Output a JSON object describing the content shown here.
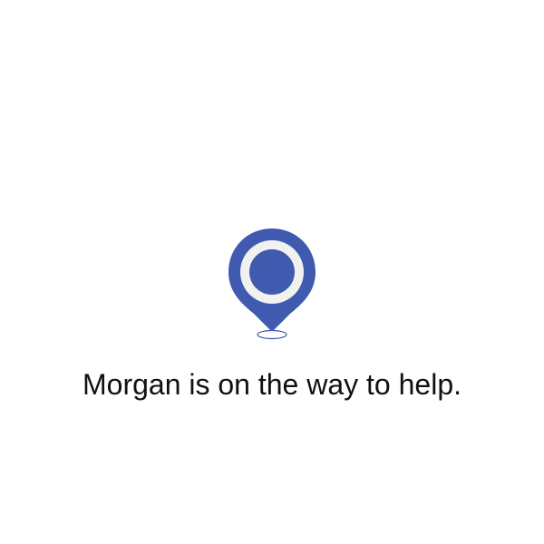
{
  "status": {
    "message": "Morgan is on the way to help."
  },
  "marker": {
    "icon": "location-pin-icon",
    "color": "#3F5AAE",
    "ring_color": "#F1F1F1"
  }
}
